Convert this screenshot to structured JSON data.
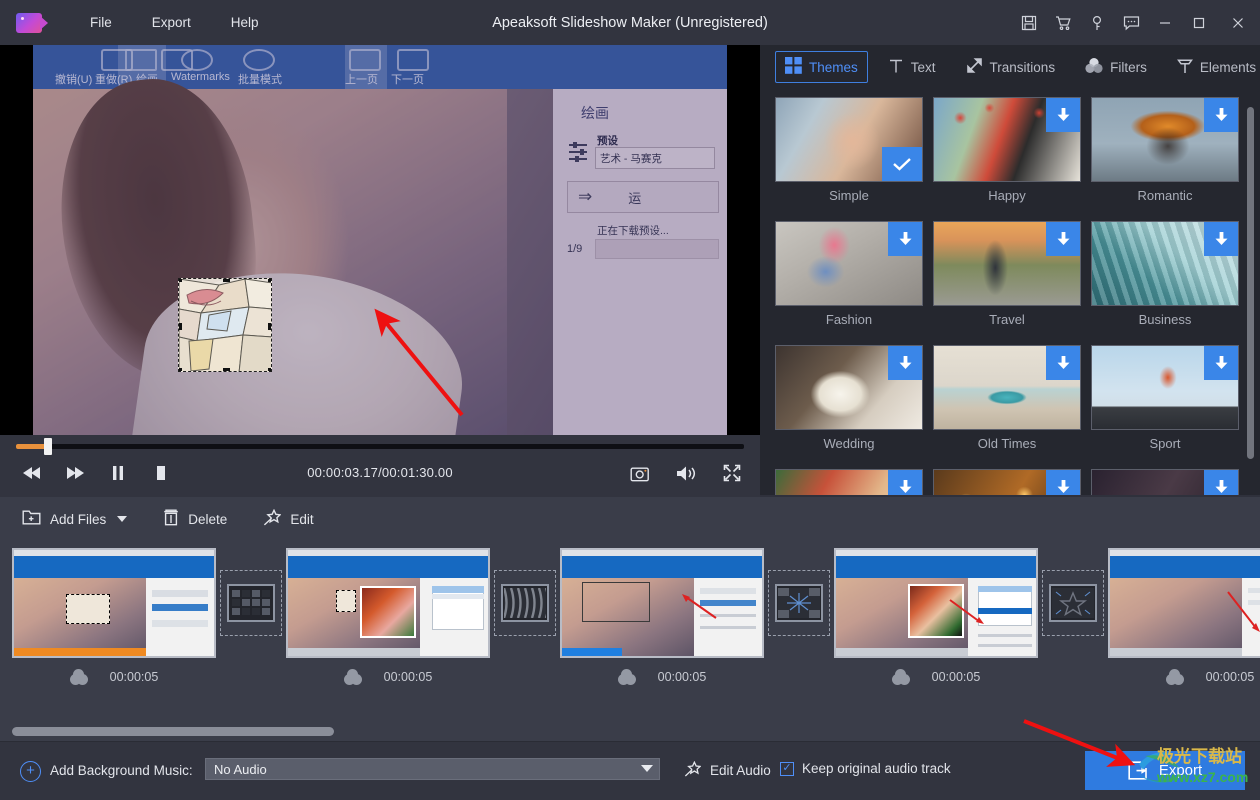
{
  "titlebar": {
    "app_title": "Apeaksoft Slideshow Maker (Unregistered)",
    "logo_name": "apeaksoft-logo",
    "menus": [
      {
        "label": "File"
      },
      {
        "label": "Export"
      },
      {
        "label": "Help"
      }
    ],
    "icons": [
      {
        "name": "save-icon"
      },
      {
        "name": "cart-icon"
      },
      {
        "name": "key-icon"
      },
      {
        "name": "feedback-icon"
      },
      {
        "name": "minimize-icon"
      },
      {
        "name": "maximize-icon"
      },
      {
        "name": "close-icon"
      }
    ]
  },
  "preview": {
    "inner_app": {
      "ribbon_items": [
        "撤销(U)",
        "重做(R)",
        "绘画",
        "Watermarks",
        "批量模式",
        "上一页",
        "下一页"
      ],
      "panel_title": "绘画",
      "preset_label": "预设",
      "preset_value": "艺术 - 马赛克",
      "run_button": "运",
      "status_text": "正在下载预设...",
      "counter": "1/9"
    }
  },
  "player": {
    "time_current": "00:00:03.17",
    "time_total": "00:01:30.00",
    "timecode": "00:00:03.17/00:01:30.00",
    "progress_percent": 3.5,
    "controls": [
      {
        "name": "rewind-button"
      },
      {
        "name": "fast-forward-button"
      },
      {
        "name": "pause-button"
      },
      {
        "name": "stop-button"
      }
    ],
    "right_controls": [
      {
        "name": "snapshot-icon"
      },
      {
        "name": "volume-icon"
      },
      {
        "name": "fullscreen-icon"
      }
    ]
  },
  "right_panel": {
    "tabs": [
      {
        "label": "Themes",
        "icon": "grid-icon",
        "active": true
      },
      {
        "label": "Text",
        "icon": "text-t-icon",
        "active": false
      },
      {
        "label": "Transitions",
        "icon": "arrows-icon",
        "active": false
      },
      {
        "label": "Filters",
        "icon": "circles-icon",
        "active": false
      },
      {
        "label": "Elements",
        "icon": "stamp-icon",
        "active": false
      }
    ],
    "themes": [
      {
        "name": "Simple",
        "state": "selected",
        "badge": "check"
      },
      {
        "name": "Happy",
        "state": "downloadable",
        "badge": "download"
      },
      {
        "name": "Romantic",
        "state": "downloadable",
        "badge": "download"
      },
      {
        "name": "Fashion",
        "state": "downloadable",
        "badge": "download"
      },
      {
        "name": "Travel",
        "state": "downloadable",
        "badge": "download"
      },
      {
        "name": "Business",
        "state": "downloadable",
        "badge": "download"
      },
      {
        "name": "Wedding",
        "state": "downloadable",
        "badge": "download"
      },
      {
        "name": "Old Times",
        "state": "downloadable",
        "badge": "download"
      },
      {
        "name": "Sport",
        "state": "downloadable",
        "badge": "download"
      },
      {
        "name": "",
        "state": "downloadable",
        "badge": "download"
      },
      {
        "name": "",
        "state": "downloadable",
        "badge": "download"
      },
      {
        "name": "",
        "state": "downloadable",
        "badge": "download"
      }
    ]
  },
  "toolbar": {
    "add_files": "Add Files",
    "delete": "Delete",
    "edit": "Edit"
  },
  "timeline": {
    "clips": [
      {
        "duration": "00:00:05"
      },
      {
        "duration": "00:00:05"
      },
      {
        "duration": "00:00:05"
      },
      {
        "duration": "00:00:05"
      },
      {
        "duration": "00:00:05"
      }
    ],
    "transitions": [
      {
        "name": "mosaic-transition"
      },
      {
        "name": "blinds-transition"
      },
      {
        "name": "zoom-out-transition"
      },
      {
        "name": "star-transition"
      }
    ]
  },
  "bottom": {
    "bgm_label": "Add Background Music:",
    "audio_value": "No Audio",
    "edit_audio": "Edit Audio",
    "keep_track": "Keep original audio track",
    "keep_track_checked": true,
    "export": "Export"
  },
  "watermark": {
    "cn_text": "极光下载站",
    "url_text": "www.xz7.com"
  },
  "colors": {
    "accent_blue": "#2f7be0",
    "tab_active": "#4f8ff7",
    "panel_bg": "#25272f",
    "chrome_bg": "#32343f",
    "timeline_bg": "#3a3d49",
    "progress_orange": "#e8913c",
    "arrow_red": "#ee1111"
  }
}
